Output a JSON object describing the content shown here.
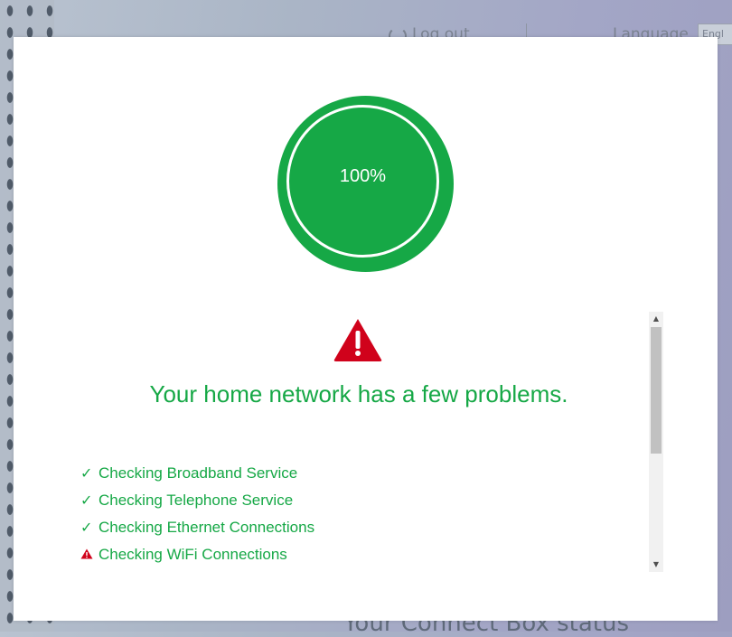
{
  "background": {
    "logout_label": "Log out",
    "language_label": "Language",
    "language_value": "Engl",
    "status_title": "Your Connect Box status"
  },
  "dialog": {
    "progress": "100%",
    "progress_value": 1.0,
    "warning_icon": "warning-triangle-icon",
    "message": "Your home network has a few problems.",
    "checks": [
      {
        "label": "Checking Broadband Service",
        "status": "ok",
        "icon": "checkmark-icon"
      },
      {
        "label": "Checking Telephone Service",
        "status": "ok",
        "icon": "checkmark-icon"
      },
      {
        "label": "Checking Ethernet Connections",
        "status": "ok",
        "icon": "checkmark-icon"
      },
      {
        "label": "Checking WiFi Connections",
        "status": "warning",
        "icon": "warning-icon"
      }
    ]
  },
  "colors": {
    "accent_green": "#16a846",
    "warning_red": "#d0021b"
  }
}
